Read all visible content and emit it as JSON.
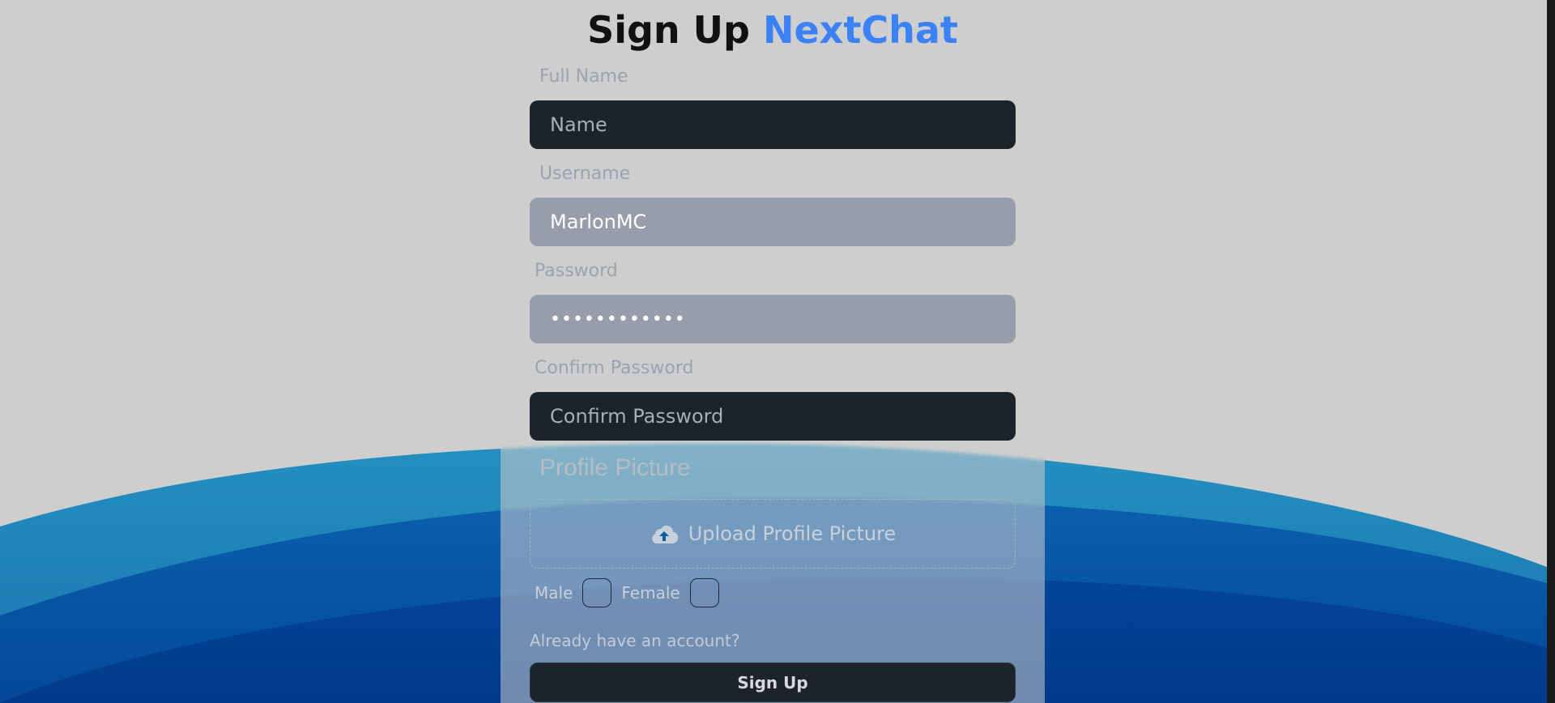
{
  "header": {
    "title_prefix": "Sign Up",
    "title_brand": "NextChat"
  },
  "form": {
    "full_name": {
      "label": "Full Name",
      "placeholder": "Name",
      "value": ""
    },
    "username": {
      "label": "Username",
      "value": "MarlonMC"
    },
    "password": {
      "label": "Password",
      "value": "••••••••••••"
    },
    "confirm_password": {
      "label": "Confirm Password",
      "placeholder": "Confirm Password",
      "value": ""
    },
    "profile_picture": {
      "label": "Profile Picture",
      "upload_label": "Upload Profile Picture",
      "icon": "cloud-upload-icon"
    },
    "gender": {
      "male_label": "Male",
      "female_label": "Female"
    },
    "login_link": "Already have an account?",
    "submit_label": "Sign Up"
  },
  "colors": {
    "brand": "#3b82f6",
    "input_dark": "#1d232b",
    "input_filled": "#979daa",
    "wave_light": "#2289bb",
    "wave_dark": "#003c8f"
  }
}
